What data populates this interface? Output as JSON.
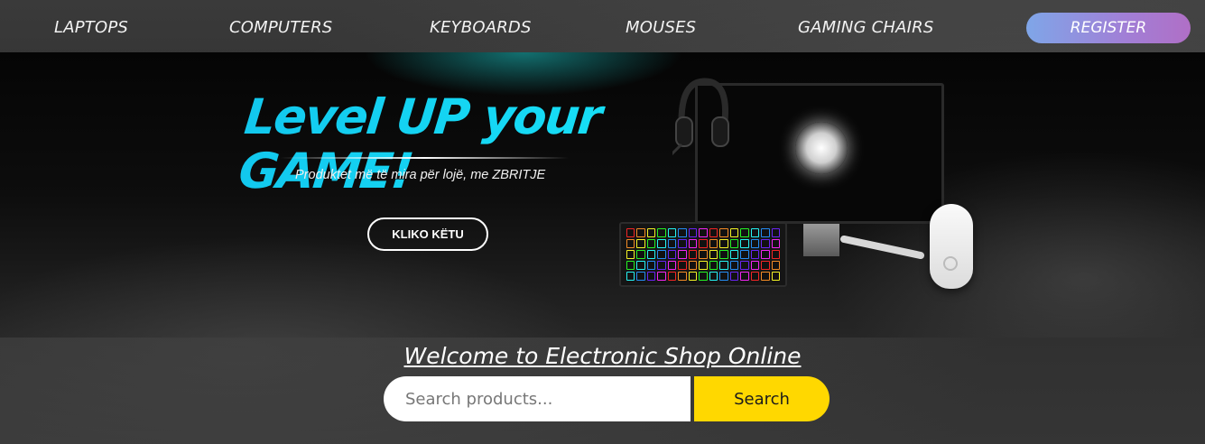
{
  "nav": {
    "items": [
      {
        "label": "LAPTOPS"
      },
      {
        "label": "COMPUTERS"
      },
      {
        "label": "KEYBOARDS"
      },
      {
        "label": "MOUSES"
      },
      {
        "label": "GAMING CHAIRS"
      }
    ],
    "register_label": "REGISTER"
  },
  "hero": {
    "title": "Level UP your GAME!",
    "subtitle": "Produktet më të mira për lojë, me ZBRITJE",
    "cta_label": "KLIKO KËTU",
    "products": [
      "headset-icon",
      "monitor-icon",
      "keyboard-icon",
      "mouse-icon"
    ]
  },
  "welcome": {
    "text": "Welcome to Electronic Shop Online"
  },
  "search": {
    "placeholder": "Search products...",
    "value": "",
    "button_label": "Search"
  },
  "colors": {
    "accent_title": "#17d6f2",
    "search_button": "#ffd800",
    "register_gradient": [
      "#7fa6e8",
      "#b06fc6"
    ]
  }
}
